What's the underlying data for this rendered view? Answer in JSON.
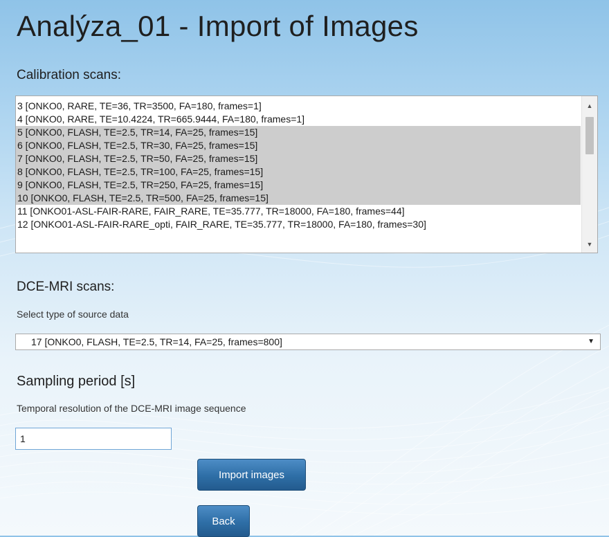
{
  "page": {
    "title": "Analýza_01 - Import of Images"
  },
  "calibration": {
    "label": "Calibration scans:",
    "items": [
      {
        "label": "3 [ONKO0, RARE, TE=36, TR=3500, FA=180, frames=1]",
        "selected": false
      },
      {
        "label": "4 [ONKO0, RARE, TE=10.4224, TR=665.9444, FA=180, frames=1]",
        "selected": false
      },
      {
        "label": "5 [ONKO0, FLASH, TE=2.5, TR=14, FA=25, frames=15]",
        "selected": true
      },
      {
        "label": "6 [ONKO0, FLASH, TE=2.5, TR=30, FA=25, frames=15]",
        "selected": true
      },
      {
        "label": "7 [ONKO0, FLASH, TE=2.5, TR=50, FA=25, frames=15]",
        "selected": true
      },
      {
        "label": "8 [ONKO0, FLASH, TE=2.5, TR=100, FA=25, frames=15]",
        "selected": true
      },
      {
        "label": "9 [ONKO0, FLASH, TE=2.5, TR=250, FA=25, frames=15]",
        "selected": true
      },
      {
        "label": "10 [ONKO0, FLASH, TE=2.5, TR=500, FA=25, frames=15]",
        "selected": true
      },
      {
        "label": "11 [ONKO01-ASL-FAIR-RARE, FAIR_RARE, TE=35.777, TR=18000, FA=180, frames=44]",
        "selected": false
      },
      {
        "label": "12 [ONKO01-ASL-FAIR-RARE_opti, FAIR_RARE, TE=35.777, TR=18000, FA=180, frames=30]",
        "selected": false
      }
    ],
    "scroll_up_icon": "triangle-up",
    "scroll_down_icon": "triangle-down"
  },
  "dce": {
    "label": "DCE-MRI scans:",
    "help": "Select type of source data",
    "selected_value": "17 [ONKO0, FLASH, TE=2.5, TR=14, FA=25, frames=800]",
    "arrow_icon": "triangle-down"
  },
  "sampling": {
    "label": "Sampling period [s]",
    "help": "Temporal resolution of the DCE-MRI image sequence",
    "value": "1"
  },
  "buttons": {
    "import_label": "Import images",
    "back_label": "Back"
  },
  "colors": {
    "button_blue": "#2e6ea6",
    "selection_gray": "#cdcdcd",
    "background_blue": "#a9d2ef"
  }
}
